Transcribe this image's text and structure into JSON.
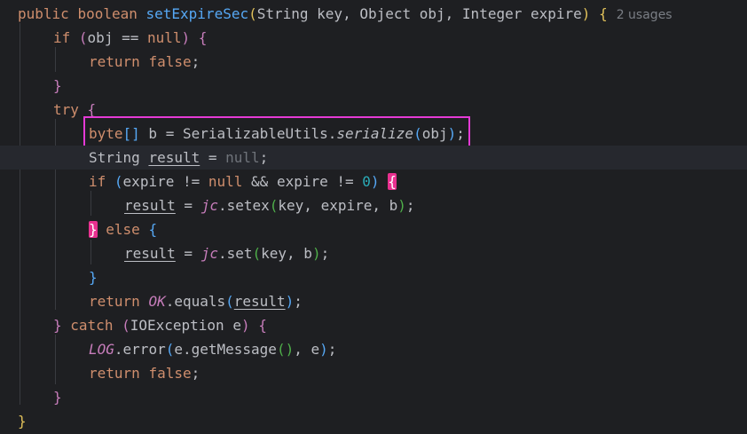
{
  "code": {
    "usages_hint": "2 usages",
    "lines": [
      {
        "tokens": [
          {
            "t": "public ",
            "c": "kw"
          },
          {
            "t": "boolean ",
            "c": "kw"
          },
          {
            "t": "setExpireSec",
            "c": "fn"
          },
          {
            "t": "(",
            "c": "p1"
          },
          {
            "t": "String key, Object obj, Integer expire",
            "c": ""
          },
          {
            "t": ")",
            "c": "p1"
          },
          {
            "t": " ",
            "c": ""
          },
          {
            "t": "{",
            "c": "p1"
          }
        ]
      },
      {
        "tokens": [
          {
            "t": "if ",
            "c": "kw"
          },
          {
            "t": "(",
            "c": "p2"
          },
          {
            "t": "obj == ",
            "c": ""
          },
          {
            "t": "null",
            "c": "kw"
          },
          {
            "t": ")",
            "c": "p2"
          },
          {
            "t": " ",
            "c": ""
          },
          {
            "t": "{",
            "c": "p2"
          }
        ]
      },
      {
        "tokens": [
          {
            "t": "return ",
            "c": "kw"
          },
          {
            "t": "false",
            "c": "kw"
          },
          {
            "t": ";",
            "c": ""
          }
        ]
      },
      {
        "tokens": [
          {
            "t": "}",
            "c": "p2"
          }
        ]
      },
      {
        "tokens": [
          {
            "t": "try ",
            "c": "kw"
          },
          {
            "t": "{",
            "c": "p2"
          }
        ]
      },
      {
        "tokens": [
          {
            "t": "byte",
            "c": "kw"
          },
          {
            "t": "[]",
            "c": "p3"
          },
          {
            "t": " b = SerializableUtils.",
            "c": ""
          },
          {
            "t": "serialize",
            "c": "call-i"
          },
          {
            "t": "(",
            "c": "p3"
          },
          {
            "t": "obj",
            "c": ""
          },
          {
            "t": ")",
            "c": "p3"
          },
          {
            "t": ";",
            "c": ""
          }
        ]
      },
      {
        "tokens": [
          {
            "t": "String ",
            "c": ""
          },
          {
            "t": "result",
            "c": "ul"
          },
          {
            "t": " = ",
            "c": ""
          },
          {
            "t": "null",
            "c": "dim"
          },
          {
            "t": ";",
            "c": ""
          }
        ]
      },
      {
        "tokens": [
          {
            "t": "if ",
            "c": "kw"
          },
          {
            "t": "(",
            "c": "p3"
          },
          {
            "t": "expire != ",
            "c": ""
          },
          {
            "t": "null",
            "c": "kw"
          },
          {
            "t": " && expire != ",
            "c": ""
          },
          {
            "t": "0",
            "c": "num"
          },
          {
            "t": ")",
            "c": "p3"
          },
          {
            "t": " ",
            "c": ""
          },
          {
            "t": "{",
            "c": "match"
          }
        ]
      },
      {
        "tokens": [
          {
            "t": "result",
            "c": "ul"
          },
          {
            "t": " = ",
            "c": ""
          },
          {
            "t": "jc",
            "c": "field"
          },
          {
            "t": ".setex",
            "c": ""
          },
          {
            "t": "(",
            "c": "p4"
          },
          {
            "t": "key, expire, b",
            "c": ""
          },
          {
            "t": ")",
            "c": "p4"
          },
          {
            "t": ";",
            "c": ""
          }
        ]
      },
      {
        "tokens": [
          {
            "t": "}",
            "c": "match"
          },
          {
            "t": " ",
            "c": ""
          },
          {
            "t": "else ",
            "c": "kw"
          },
          {
            "t": "{",
            "c": "p3"
          }
        ]
      },
      {
        "tokens": [
          {
            "t": "result",
            "c": "ul"
          },
          {
            "t": " = ",
            "c": ""
          },
          {
            "t": "jc",
            "c": "field"
          },
          {
            "t": ".set",
            "c": ""
          },
          {
            "t": "(",
            "c": "p4"
          },
          {
            "t": "key, b",
            "c": ""
          },
          {
            "t": ")",
            "c": "p4"
          },
          {
            "t": ";",
            "c": ""
          }
        ]
      },
      {
        "tokens": [
          {
            "t": "}",
            "c": "p3"
          }
        ]
      },
      {
        "tokens": [
          {
            "t": "return ",
            "c": "kw"
          },
          {
            "t": "OK",
            "c": "field"
          },
          {
            "t": ".equals",
            "c": ""
          },
          {
            "t": "(",
            "c": "p3"
          },
          {
            "t": "result",
            "c": "ul"
          },
          {
            "t": ")",
            "c": "p3"
          },
          {
            "t": ";",
            "c": ""
          }
        ]
      },
      {
        "tokens": [
          {
            "t": "}",
            "c": "p2"
          },
          {
            "t": " ",
            "c": ""
          },
          {
            "t": "catch ",
            "c": "kw"
          },
          {
            "t": "(",
            "c": "p2"
          },
          {
            "t": "IOException e",
            "c": ""
          },
          {
            "t": ")",
            "c": "p2"
          },
          {
            "t": " ",
            "c": ""
          },
          {
            "t": "{",
            "c": "p2"
          }
        ]
      },
      {
        "tokens": [
          {
            "t": "LOG",
            "c": "field"
          },
          {
            "t": ".error",
            "c": ""
          },
          {
            "t": "(",
            "c": "p3"
          },
          {
            "t": "e.getMessage",
            "c": ""
          },
          {
            "t": "()",
            "c": "p4"
          },
          {
            "t": ", e",
            "c": ""
          },
          {
            "t": ")",
            "c": "p3"
          },
          {
            "t": ";",
            "c": ""
          }
        ]
      },
      {
        "tokens": [
          {
            "t": "return ",
            "c": "kw"
          },
          {
            "t": "false",
            "c": "kw"
          },
          {
            "t": ";",
            "c": ""
          }
        ]
      },
      {
        "tokens": [
          {
            "t": "}",
            "c": "p2"
          }
        ]
      },
      {
        "tokens": [
          {
            "t": "}",
            "c": "p1"
          }
        ]
      }
    ]
  }
}
